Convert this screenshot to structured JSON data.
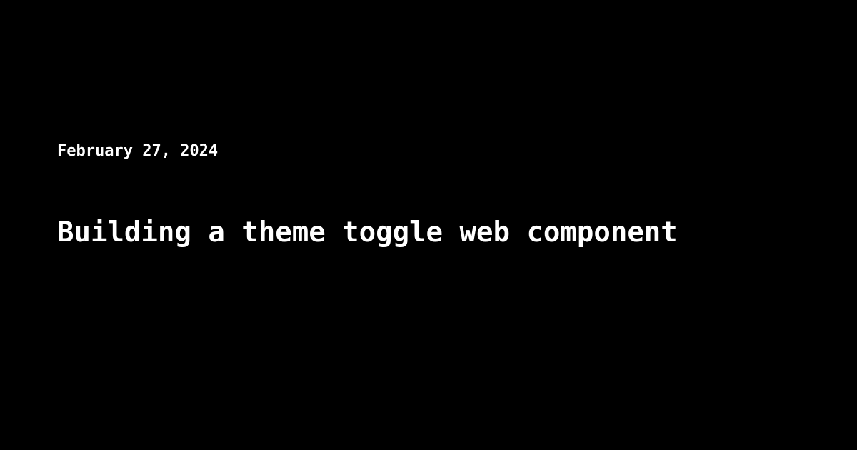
{
  "post": {
    "date": "February 27, 2024",
    "title": "Building a theme toggle web component"
  },
  "colors": {
    "background": "#000000",
    "text": "#ffffff"
  }
}
